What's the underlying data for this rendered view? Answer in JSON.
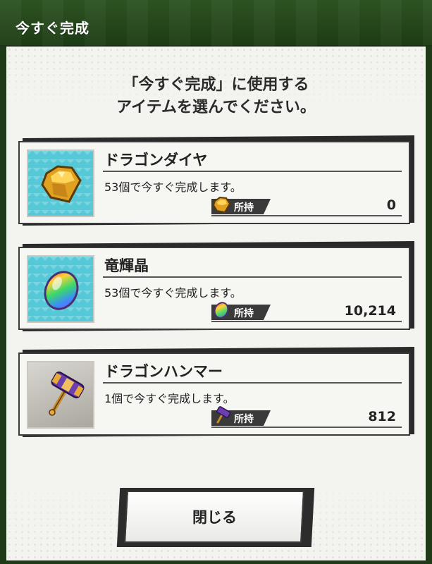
{
  "header": {
    "title": "今すぐ完成"
  },
  "instruction": {
    "line1": "「今すぐ完成」に使用する",
    "line2": "アイテムを選んでください。"
  },
  "items": [
    {
      "name": "ドラゴンダイヤ",
      "description": "53個で今すぐ完成します。",
      "owned_label": "所持",
      "owned_count": "0",
      "icon": "gold-gem-icon"
    },
    {
      "name": "竜輝晶",
      "description": "53個で今すぐ完成します。",
      "owned_label": "所持",
      "owned_count": "10,214",
      "icon": "rainbow-crystal-icon"
    },
    {
      "name": "ドラゴンハンマー",
      "description": "1個で今すぐ完成します。",
      "owned_label": "所持",
      "owned_count": "812",
      "icon": "dragon-hammer-icon"
    }
  ],
  "close_button": {
    "label": "閉じる"
  },
  "colors": {
    "header_bg": "#1c3b14",
    "panel_bg": "#f3f3ef",
    "thumb_cyan": "#55c9d8",
    "border": "#3a3a3a"
  }
}
